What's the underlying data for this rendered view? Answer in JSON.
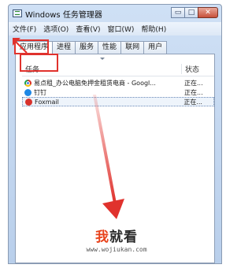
{
  "window": {
    "title": "Windows 任务管理器",
    "controls": {
      "minimize": "▭",
      "maximize": "□",
      "close": "✕"
    }
  },
  "menu": [
    "文件(F)",
    "选项(O)",
    "查看(V)",
    "窗口(W)",
    "帮助(H)"
  ],
  "tabs": [
    "应用程序",
    "进程",
    "服务",
    "性能",
    "联网",
    "用户"
  ],
  "active_tab": "应用程序",
  "list": {
    "headers": {
      "task": "任务",
      "status": "状态"
    },
    "rows": [
      {
        "name": "易点租_办公电脑免押金租赁电商 - Googl...",
        "status": "正在...",
        "icon": "chrome-icon"
      },
      {
        "name": "钉钉",
        "status": "正在...",
        "icon": "dingtalk-icon"
      },
      {
        "name": "Foxmail",
        "status": "正在...",
        "icon": "foxmail-icon",
        "selected": true
      }
    ]
  },
  "watermark": {
    "title_first": "我",
    "title_rest": "就看",
    "url": "www.wojiukan.com"
  },
  "colors": {
    "annotation": "#e0322d",
    "arrow": "#e0322d",
    "brand_orange": "#e8431c"
  }
}
